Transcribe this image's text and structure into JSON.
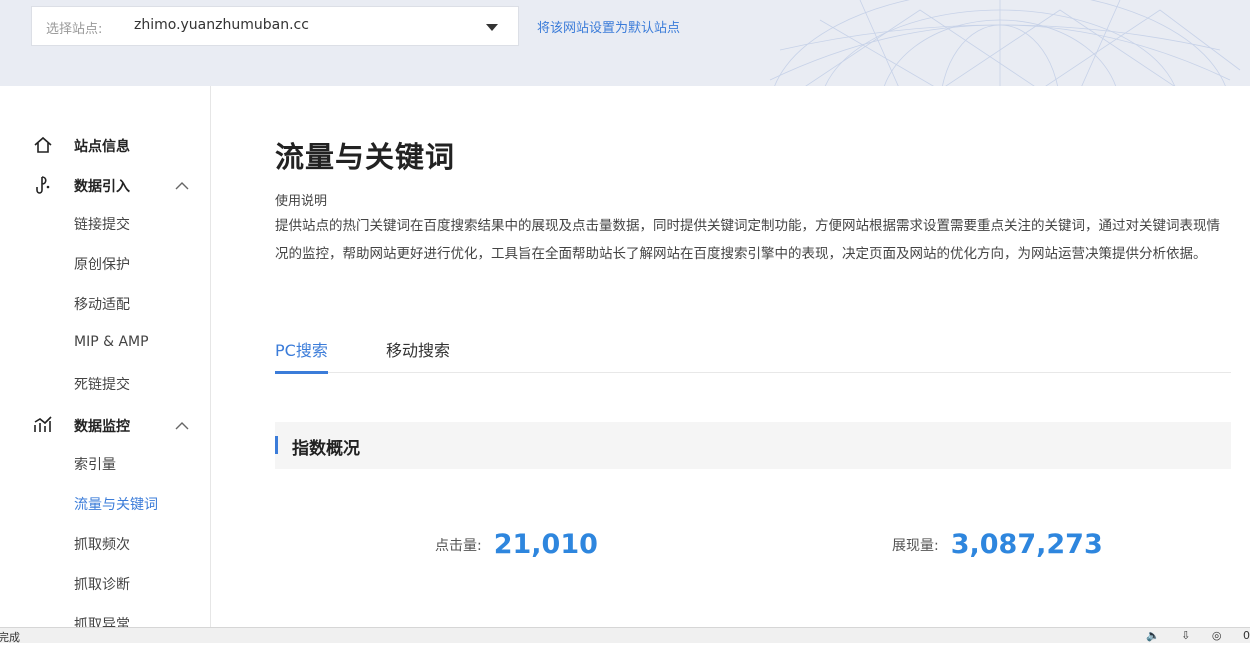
{
  "header": {
    "site_label": "选择站点:",
    "site_value": "zhimo.yuanzhumuban.cc",
    "set_default_link": "将该网站设置为默认站点"
  },
  "sidebar": {
    "site_info": "站点信息",
    "data_import": {
      "label": "数据引入",
      "items": [
        "链接提交",
        "原创保护",
        "移动适配",
        "MIP & AMP",
        "死链提交"
      ]
    },
    "data_monitor": {
      "label": "数据监控",
      "items": [
        "索引量",
        "流量与关键词",
        "抓取频次",
        "抓取诊断",
        "抓取异常"
      ]
    },
    "active_item": "流量与关键词"
  },
  "main": {
    "title": "流量与关键词",
    "usage_title": "使用说明",
    "usage_desc": "提供站点的热门关键词在百度搜索结果中的展现及点击量数据，同时提供关键词定制功能，方便网站根据需求设置需要重点关注的关键词，通过对关键词表现情况的监控，帮助网站更好进行优化，工具旨在全面帮助站长了解网站在百度搜索引擎中的表现，决定页面及网站的优化方向，为网站运营决策提供分析依据。",
    "tabs": [
      "PC搜索",
      "移动搜索"
    ],
    "active_tab": "PC搜索",
    "section_title": "指数概况",
    "stats": {
      "clicks_label": "点击量:",
      "clicks_value": "21,010",
      "impressions_label": "展现量:",
      "impressions_value": "3,087,273"
    }
  },
  "statusbar": {
    "left_text": "完成",
    "zoom": "0"
  },
  "colors": {
    "accent": "#3b7cd9",
    "stat_value": "#2e86de",
    "header_bg": "#e9ecf3"
  }
}
